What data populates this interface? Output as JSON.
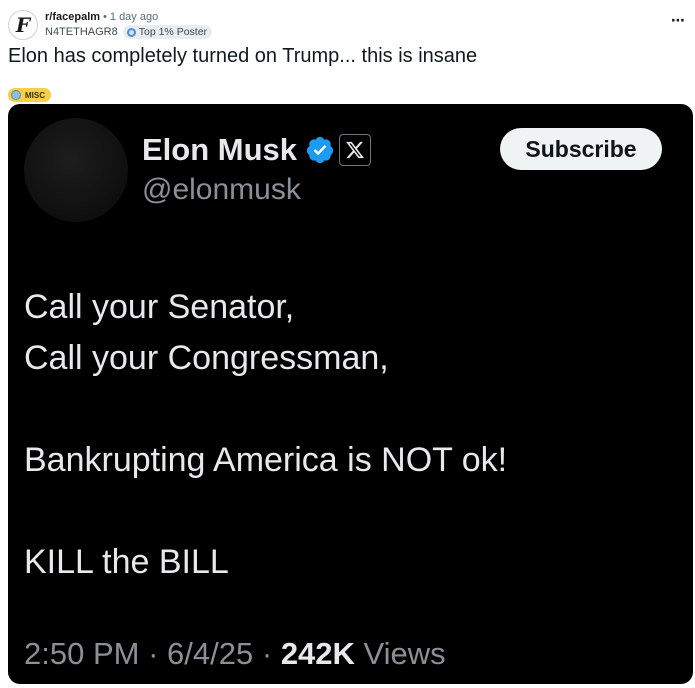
{
  "post": {
    "subreddit": "r/facepalm",
    "age": "1 day ago",
    "separator": "•",
    "username": "N4TETHAGR8",
    "user_badge": "Top 1% Poster",
    "more_icon": "⋯",
    "title": "Elon has completely turned on Trump... this is insane",
    "flair": "MISC",
    "subreddit_icon_letter": "F"
  },
  "tweet": {
    "name": "Elon Musk",
    "handle": "@elonmusk",
    "subscribe_label": "Subscribe",
    "lines": [
      "Call your Senator,",
      "Call your Congressman,",
      "",
      "Bankrupting America is NOT ok!",
      "",
      "KILL the BILL"
    ],
    "time": "2:50 PM",
    "date": "6/4/25",
    "dot": "·",
    "views_count": "242K",
    "views_label": "Views"
  },
  "colors": {
    "verified_blue": "#1d9bf0",
    "flair_yellow": "#f4d04a",
    "tweet_background": "#000000"
  }
}
